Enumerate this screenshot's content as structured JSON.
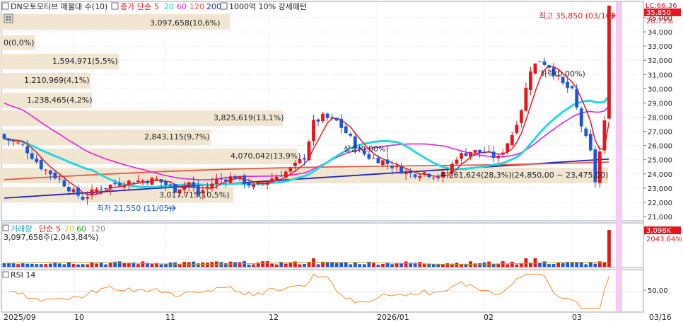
{
  "header": {
    "stock_name": "DN오토모티브 매물대 수(10)",
    "ma_title": "종가 단순",
    "ma_periods": [
      "5",
      "20",
      "60",
      "120",
      "200"
    ],
    "band_title": "1000억 10% 강세패턴"
  },
  "price_panel": {
    "right_top_label": "LC:66.36",
    "last_price": "35,850",
    "last_change_pct": "28.73%",
    "high_label": "최고 35,850 (03/16)",
    "low_label": "최저 21,550 (11/05)",
    "yticks": [
      "35,000",
      "34,000",
      "33,000",
      "32,000",
      "31,000",
      "30,000",
      "29,000",
      "28,000",
      "27,000",
      "26,000",
      "25,000",
      "24,000",
      "23,000",
      "22,000",
      "21,000"
    ],
    "annotations": [
      {
        "text": "하락(0.00%)"
      },
      {
        "text": "상승(0.00%)"
      },
      {
        "text": "4,261,624(28,3%)(24,850,00 ~ 23,475,00)"
      },
      {
        "text": "3,017,715(10,5%)"
      }
    ],
    "volume_profile": [
      {
        "label": "3,097,658(10,6%)"
      },
      {
        "label": "0(0,0%)"
      },
      {
        "label": "1,594,971(5,5%)"
      },
      {
        "label": "1,210,969(4,1%)"
      },
      {
        "label": "1,238,465(4,2%)"
      },
      {
        "label": "3,825,619(13,1%)"
      },
      {
        "label": "2,843,115(9,7%)"
      },
      {
        "label": "4,070,042(13,9%)"
      }
    ]
  },
  "volume_panel": {
    "title": "거래량",
    "ma_title": "단순",
    "ma_periods": [
      "5",
      "20",
      "60",
      "120"
    ],
    "value_text": "3,097,658주(2,043,84%)",
    "last_value": "3,098K",
    "last_pct": "2043.64%"
  },
  "rsi_panel": {
    "title": "RSI 14",
    "tick": "50,00"
  },
  "x_axis": {
    "labels": [
      "2025/09",
      "10",
      "11",
      "12",
      "2026/01",
      "02",
      "03",
      "03/16"
    ]
  },
  "colors": {
    "up": "#e8141c",
    "down": "#1a56d6",
    "ma5": "#e8141c",
    "ma20": "#22d8e0",
    "ma60": "#e020d8",
    "ma120": "#ee5540",
    "ma200": "#1f24b8",
    "profile": "#f2e3cc",
    "highlight": "#f8c8f4",
    "rsi": "#f28a20"
  },
  "chart_data": {
    "type": "candlestick",
    "title": "DN오토모티브",
    "x_range": [
      "2025-09-01",
      "2026-03-16"
    ],
    "ylim": [
      21000,
      35850
    ],
    "high": {
      "value": 35850,
      "date": "03/16"
    },
    "low": {
      "value": 21550,
      "date": "11/05"
    },
    "last_close": 35850,
    "last_volume": 3097658,
    "series": [
      {
        "name": "5"
      },
      {
        "name": "20"
      },
      {
        "name": "60"
      },
      {
        "name": "120"
      },
      {
        "name": "200"
      }
    ],
    "volume_profile_values": [
      3097658,
      0,
      1594971,
      1210969,
      1238465,
      3825619,
      2843115,
      4070042
    ],
    "volume_profile_pct": [
      10.6,
      0.0,
      5.5,
      4.1,
      4.2,
      13.1,
      9.7,
      13.9
    ]
  }
}
